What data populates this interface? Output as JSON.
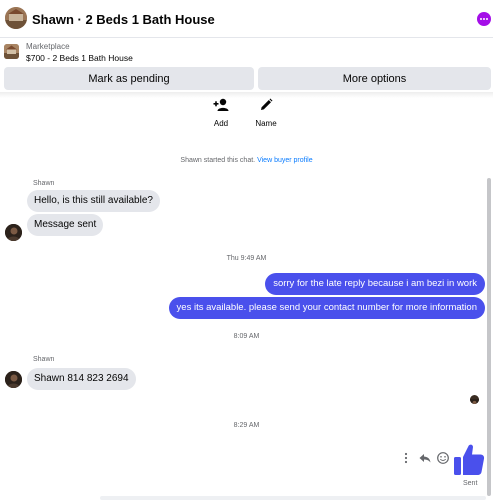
{
  "header": {
    "title": "Shawn · 2 Beds 1 Bath House",
    "more_icon": "more-dots-icon",
    "accent_color": "#a40ee8"
  },
  "listing": {
    "label": "Marketplace",
    "price_title": "$700 - 2 Beds 1 Bath House"
  },
  "actions": {
    "mark_pending": "Mark as pending",
    "more_options": "More options"
  },
  "quick_actions": [
    {
      "label": "Add",
      "icon": "add-person-icon"
    },
    {
      "label": "Name",
      "icon": "pencil-icon"
    }
  ],
  "chat": {
    "started_text": "Shawn started this chat.",
    "view_profile": "View buyer profile",
    "messages_group1": {
      "sender": "Shawn",
      "bubbles": [
        "Hello, is this still available?",
        "Message sent"
      ]
    },
    "timestamp1": "Thu 9:49 AM",
    "outgoing": [
      "sorry for the late reply because i am bezi in work",
      "yes its available. please send your contact number for more information"
    ],
    "timestamp2": "8:09 AM",
    "messages_group2": {
      "sender": "Shawn",
      "bubbles": [
        "Shawn 814 823 2694"
      ]
    },
    "timestamp3": "8:29 AM",
    "sent_status": "Sent",
    "outgoing_color": "#4a50ec",
    "like_color": "#4a50ec"
  }
}
